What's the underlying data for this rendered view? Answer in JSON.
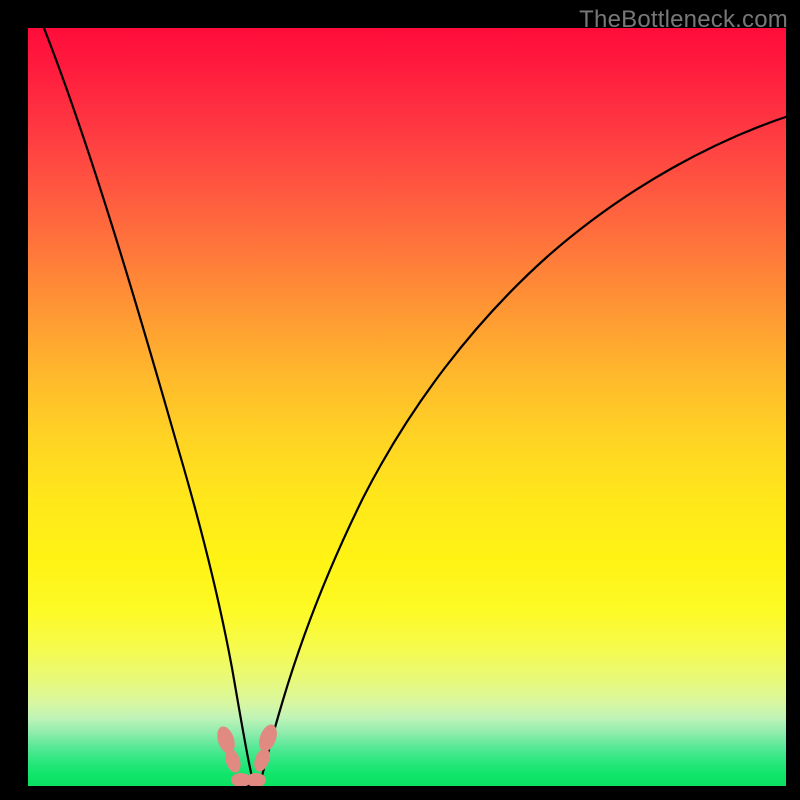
{
  "watermark": "TheBottleneck.com",
  "chart_data": {
    "type": "line",
    "title": "",
    "xlabel": "",
    "ylabel": "",
    "xlim": [
      0,
      1
    ],
    "ylim": [
      0,
      1
    ],
    "note": "Bottleneck-style heatmap background with V-shaped black curve. Units unlabeled; values are normalized to axis range inferred from pixel positions.",
    "series": [
      {
        "name": "left-branch",
        "x": [
          0.018,
          0.06,
          0.1,
          0.14,
          0.175,
          0.205,
          0.228,
          0.246,
          0.26,
          0.27,
          0.279
        ],
        "y": [
          1.0,
          0.82,
          0.64,
          0.47,
          0.33,
          0.21,
          0.125,
          0.065,
          0.03,
          0.012,
          0.003
        ]
      },
      {
        "name": "right-branch",
        "x": [
          0.3,
          0.31,
          0.325,
          0.345,
          0.375,
          0.42,
          0.48,
          0.56,
          0.66,
          0.78,
          0.91,
          1.0
        ],
        "y": [
          0.003,
          0.012,
          0.033,
          0.075,
          0.14,
          0.235,
          0.35,
          0.47,
          0.59,
          0.7,
          0.79,
          0.84
        ]
      },
      {
        "name": "trough",
        "x": [
          0.279,
          0.29,
          0.3
        ],
        "y": [
          0.003,
          0.0,
          0.003
        ]
      }
    ],
    "markers": [
      {
        "name": "left-marker-upper",
        "x": 0.263,
        "y": 0.06
      },
      {
        "name": "left-marker-lower",
        "x": 0.272,
        "y": 0.032
      },
      {
        "name": "right-marker-upper",
        "x": 0.318,
        "y": 0.062
      },
      {
        "name": "right-marker-lower",
        "x": 0.31,
        "y": 0.034
      },
      {
        "name": "trough-marker-left",
        "x": 0.282,
        "y": 0.008
      },
      {
        "name": "trough-marker-right",
        "x": 0.298,
        "y": 0.008
      }
    ],
    "gradient_stops": [
      {
        "pos": 0.0,
        "color": "#ff0c3a"
      },
      {
        "pos": 0.3,
        "color": "#ff7a3a"
      },
      {
        "pos": 0.6,
        "color": "#ffe71b"
      },
      {
        "pos": 0.9,
        "color": "#c0f3b8"
      },
      {
        "pos": 1.0,
        "color": "#0ce061"
      }
    ]
  }
}
